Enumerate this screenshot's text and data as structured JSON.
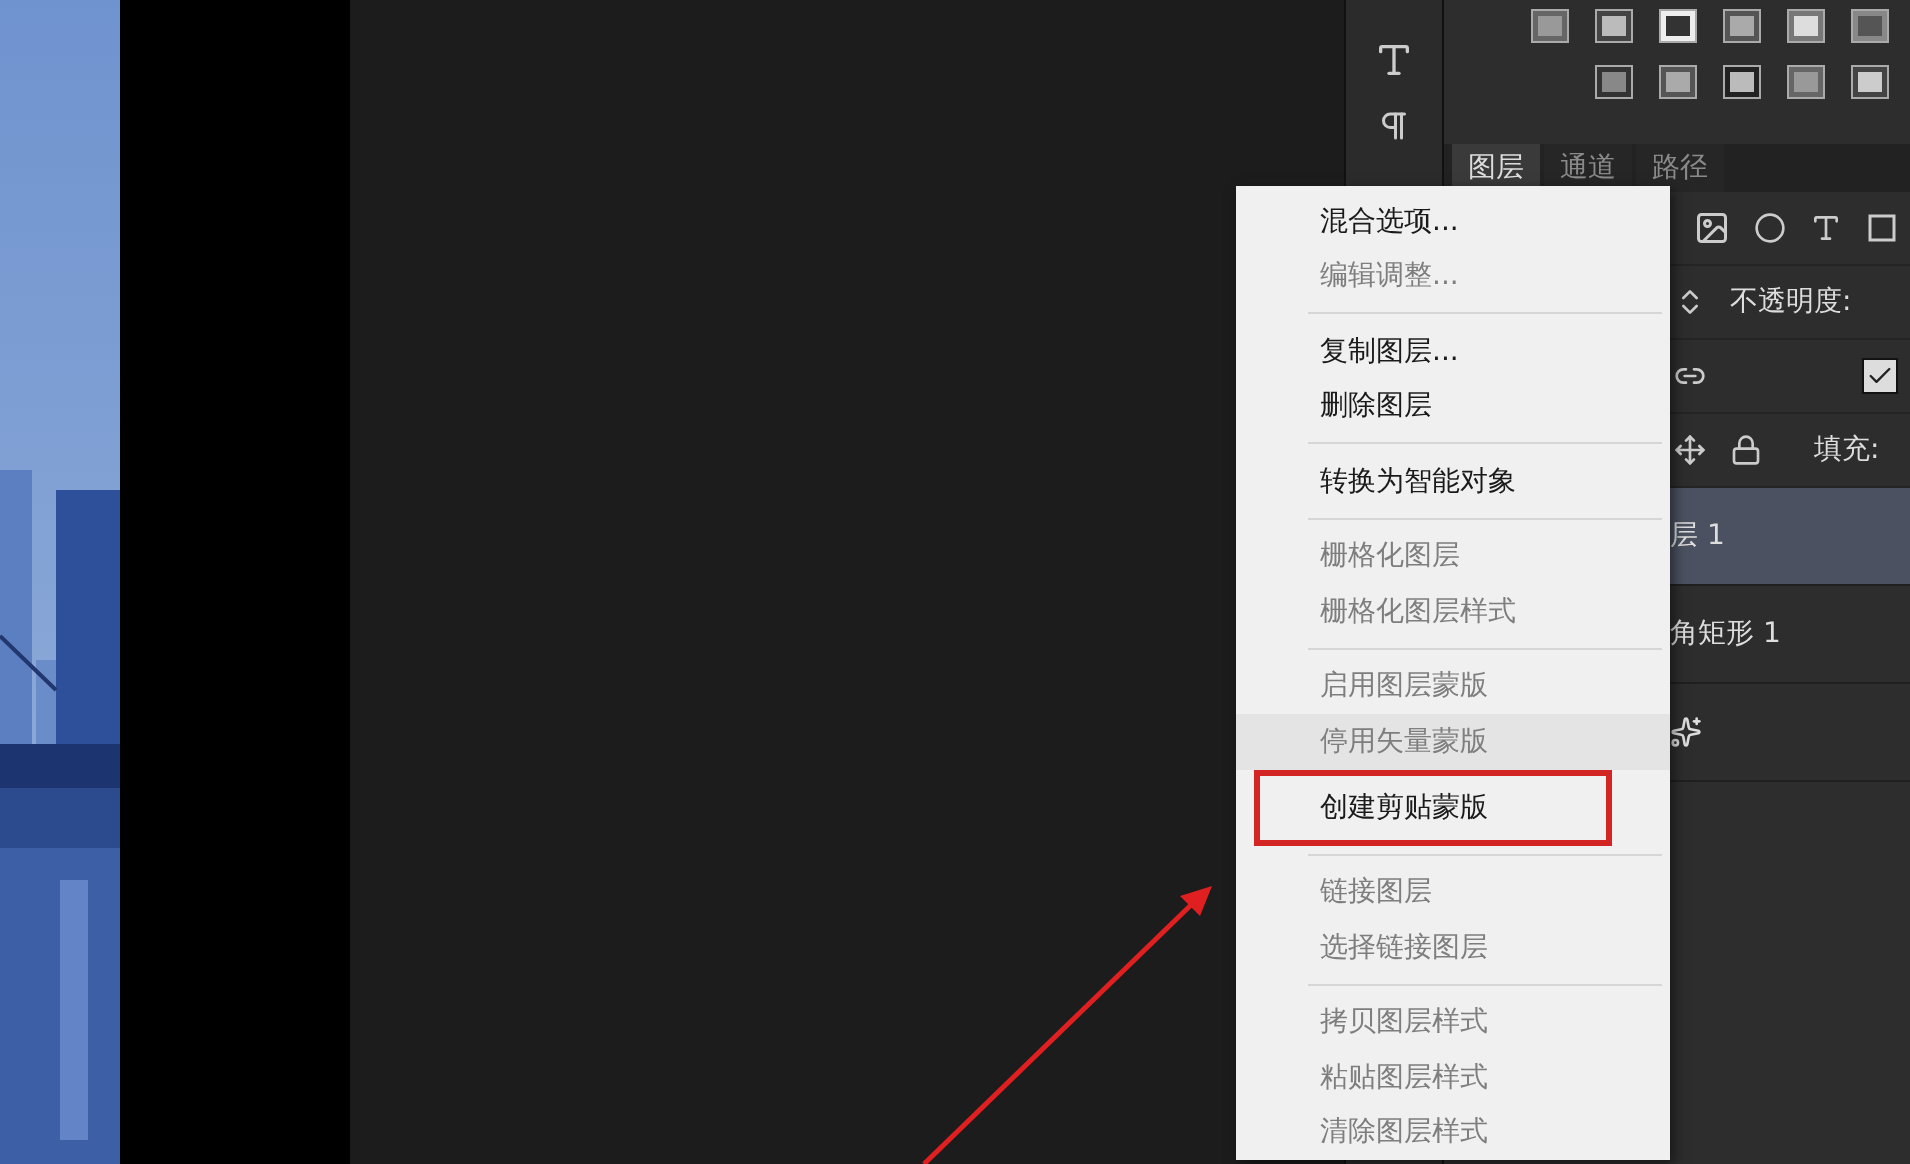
{
  "layers_panel": {
    "tabs": [
      {
        "label": "图层",
        "selected": true
      },
      {
        "label": "通道",
        "selected": false
      },
      {
        "label": "路径",
        "selected": false
      }
    ],
    "opacity_label": "不透明度:",
    "fill_label": "填充:",
    "lock_checked": true,
    "layers": [
      {
        "name": "层 1",
        "selected": true,
        "kind": "text"
      },
      {
        "name": "角矩形 1",
        "selected": false,
        "kind": "text"
      },
      {
        "kind": "effect",
        "selected": false
      }
    ]
  },
  "context_menu": {
    "groups": [
      [
        {
          "label": "混合选项...",
          "disabled": false,
          "highlighted": false
        },
        {
          "label": "编辑调整...",
          "disabled": true,
          "highlighted": false
        }
      ],
      [
        {
          "label": "复制图层...",
          "disabled": false,
          "highlighted": false
        },
        {
          "label": "删除图层",
          "disabled": false,
          "highlighted": false
        }
      ],
      [
        {
          "label": "转换为智能对象",
          "disabled": false,
          "highlighted": false
        }
      ],
      [
        {
          "label": "栅格化图层",
          "disabled": true,
          "highlighted": false
        },
        {
          "label": "栅格化图层样式",
          "disabled": true,
          "highlighted": false
        }
      ],
      [
        {
          "label": "启用图层蒙版",
          "disabled": true,
          "highlighted": false
        },
        {
          "label": "停用矢量蒙版",
          "disabled": true,
          "highlighted": true
        },
        {
          "label": "创建剪贴蒙版",
          "disabled": false,
          "highlighted": false,
          "annotated": true
        }
      ],
      [
        {
          "label": "链接图层",
          "disabled": true,
          "highlighted": false
        },
        {
          "label": "选择链接图层",
          "disabled": true,
          "highlighted": false
        }
      ],
      [
        {
          "label": "拷贝图层样式",
          "disabled": true,
          "highlighted": false
        },
        {
          "label": "粘贴图层样式",
          "disabled": true,
          "highlighted": false
        },
        {
          "label": "清除图层样式",
          "disabled": true,
          "highlighted": false
        }
      ]
    ]
  }
}
